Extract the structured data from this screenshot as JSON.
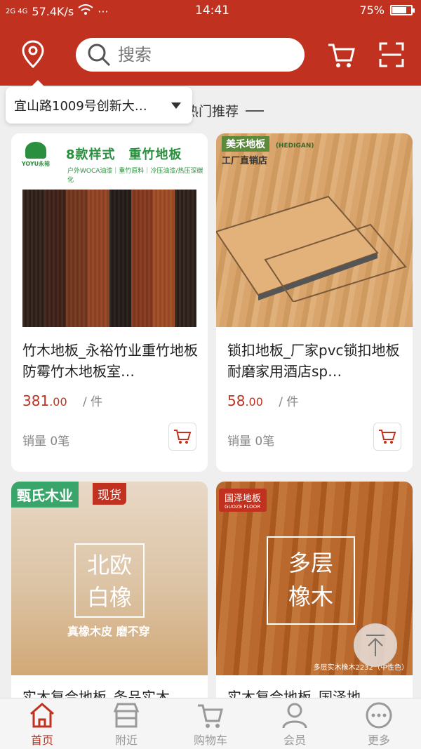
{
  "status_bar": {
    "signal": "2G 4G",
    "speed": "57.4K/s",
    "dots": "···",
    "time": "14:41",
    "battery": "75%",
    "battery_level": 0.75
  },
  "header": {
    "search_placeholder": "搜索"
  },
  "location": {
    "text": "宜山路1009号创新大…"
  },
  "section": {
    "title": "热门推荐"
  },
  "products": [
    {
      "name": "竹木地板_永裕竹业重竹地板防霉竹木地板室…",
      "price_int": "381",
      "price_dec": ".00",
      "unit": "/ 件",
      "sales": "销量 0笔",
      "image": {
        "brand": "YOYU永裕",
        "title": "8款样式　重竹地板",
        "subtitle": "户外WOCA油漆｜重竹原料｜冷压油漆/热压深碳化"
      }
    },
    {
      "name": "锁扣地板_厂家pvc锁扣地板耐磨家用酒店sp…",
      "price_int": "58",
      "price_dec": ".00",
      "unit": "/ 件",
      "sales": "销量 0笔",
      "image": {
        "brand": "美禾地板",
        "brand_sub": "(HEDIGAN)",
        "slogan": "工厂直销店"
      }
    },
    {
      "name": "实木复合地板_条品实木…",
      "image": {
        "tag": "甄氏木业",
        "badge": "现货",
        "frame_text_1": "北欧",
        "frame_text_2": "白橡",
        "caption": "真橡木皮 磨不穿"
      }
    },
    {
      "name": "实木复合地板_国泽地…",
      "image": {
        "logo": "国泽地板",
        "logo_sub": "GUOZE FLOOR",
        "frame_text_1": "多层",
        "frame_text_2": "橡木",
        "caption": "多层实木橡木2232（中性色）"
      }
    }
  ],
  "bottom_nav": [
    {
      "label": "首页",
      "icon": "home-icon",
      "active": true
    },
    {
      "label": "附近",
      "icon": "store-icon",
      "active": false
    },
    {
      "label": "购物车",
      "icon": "cart-icon",
      "active": false
    },
    {
      "label": "会员",
      "icon": "user-icon",
      "active": false
    },
    {
      "label": "更多",
      "icon": "more-icon",
      "active": false
    }
  ],
  "colors": {
    "brand_red": "#c0311f",
    "price_red": "#c0311f"
  }
}
